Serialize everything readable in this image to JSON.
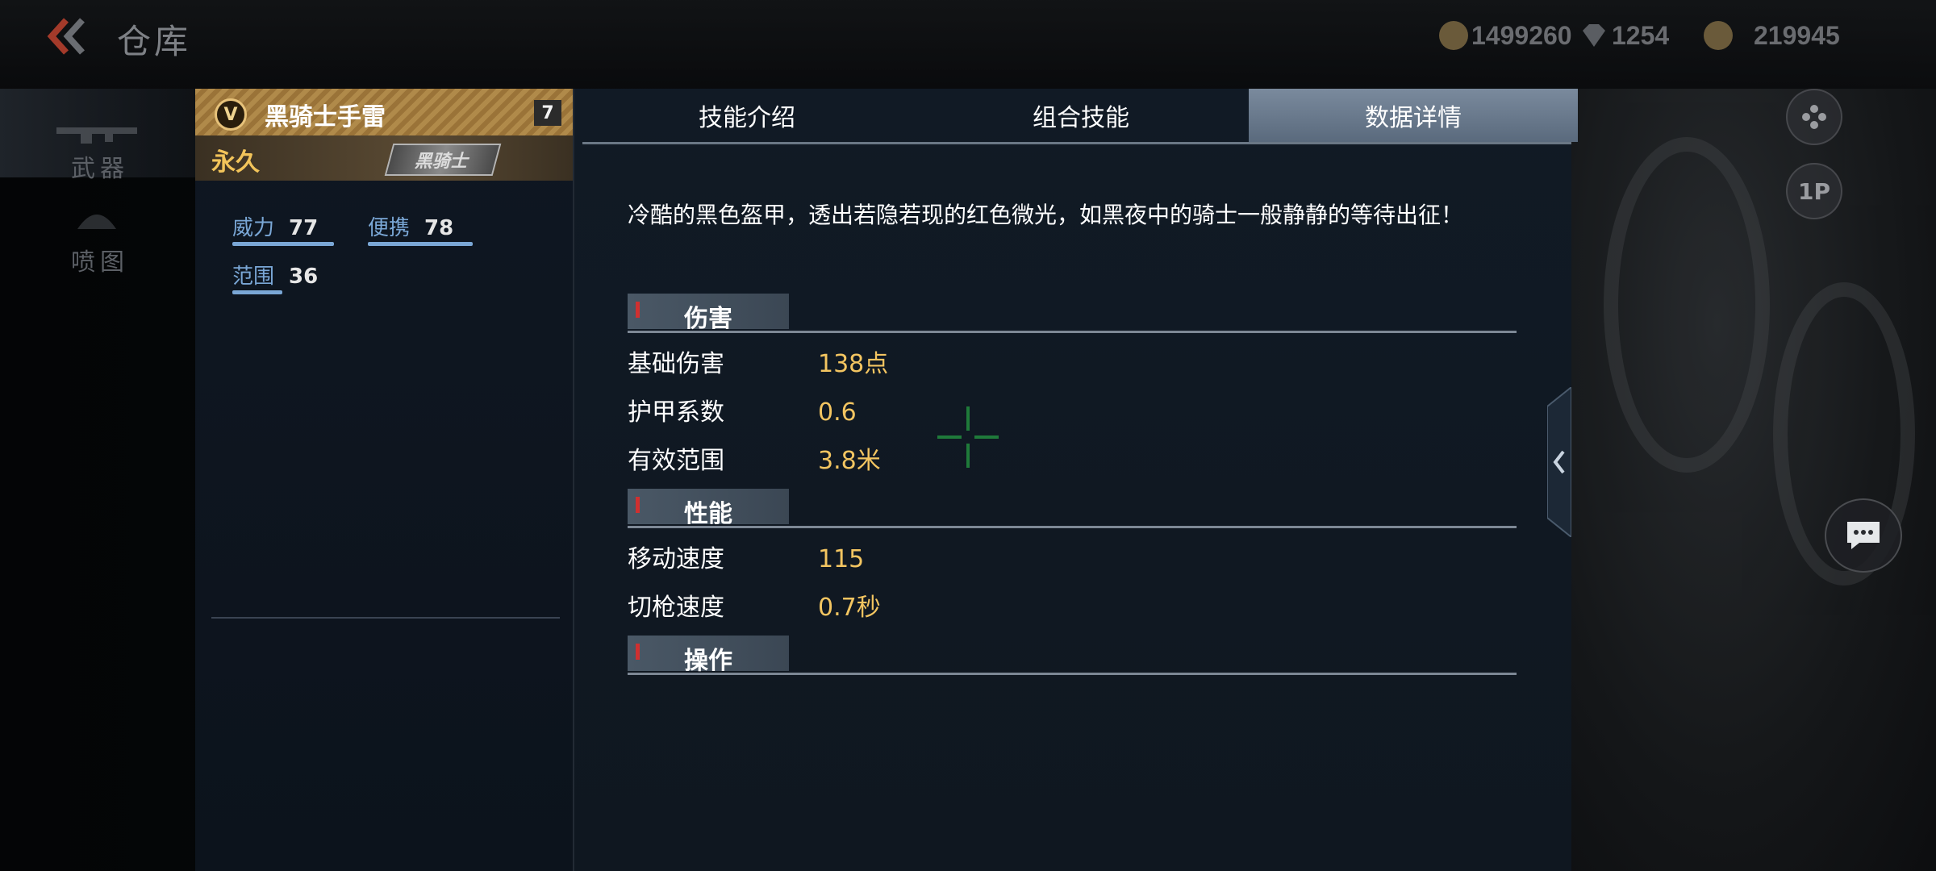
{
  "header": {
    "title": "仓库",
    "currencies": [
      {
        "icon": "gold-coin-icon",
        "value": "1499260"
      },
      {
        "icon": "diamond-icon",
        "value": "1254"
      },
      {
        "icon": "voucher-icon",
        "value": "219945"
      }
    ]
  },
  "sidebar": {
    "items": [
      {
        "label": "武器",
        "icon": "rifle-icon",
        "active": true
      },
      {
        "label": "喷图",
        "icon": "spray-icon",
        "active": false
      }
    ]
  },
  "item": {
    "badge": "V",
    "name": "黑骑士手雷",
    "level": "7",
    "duration": "永久",
    "tag": "黑骑士",
    "stats": [
      {
        "label": "威力",
        "value": "77"
      },
      {
        "label": "便携",
        "value": "78"
      },
      {
        "label": "范围",
        "value": "36"
      }
    ]
  },
  "tabs": [
    {
      "label": "技能介绍",
      "active": false
    },
    {
      "label": "组合技能",
      "active": false
    },
    {
      "label": "数据详情",
      "active": true
    }
  ],
  "details": {
    "description": "冷酷的黑色盔甲，透出若隐若现的红色微光，如黑夜中的骑士一般静静的等待出征！",
    "sections": [
      {
        "title": "伤害",
        "rows": [
          {
            "label": "基础伤害",
            "value": "138点"
          },
          {
            "label": "护甲系数",
            "value": "0.6"
          },
          {
            "label": "有效范围",
            "value": "3.8米"
          }
        ]
      },
      {
        "title": "性能",
        "rows": [
          {
            "label": "移动速度",
            "value": "115"
          },
          {
            "label": "切枪速度",
            "value": "0.7秒"
          }
        ]
      },
      {
        "title": "操作",
        "rows": []
      }
    ]
  },
  "side_buttons": {
    "mode_label": "1P"
  },
  "colors": {
    "accent_gold": "#f3c561",
    "stat_blue": "#7aa7d6",
    "tab_active": "#6a7a8d"
  }
}
